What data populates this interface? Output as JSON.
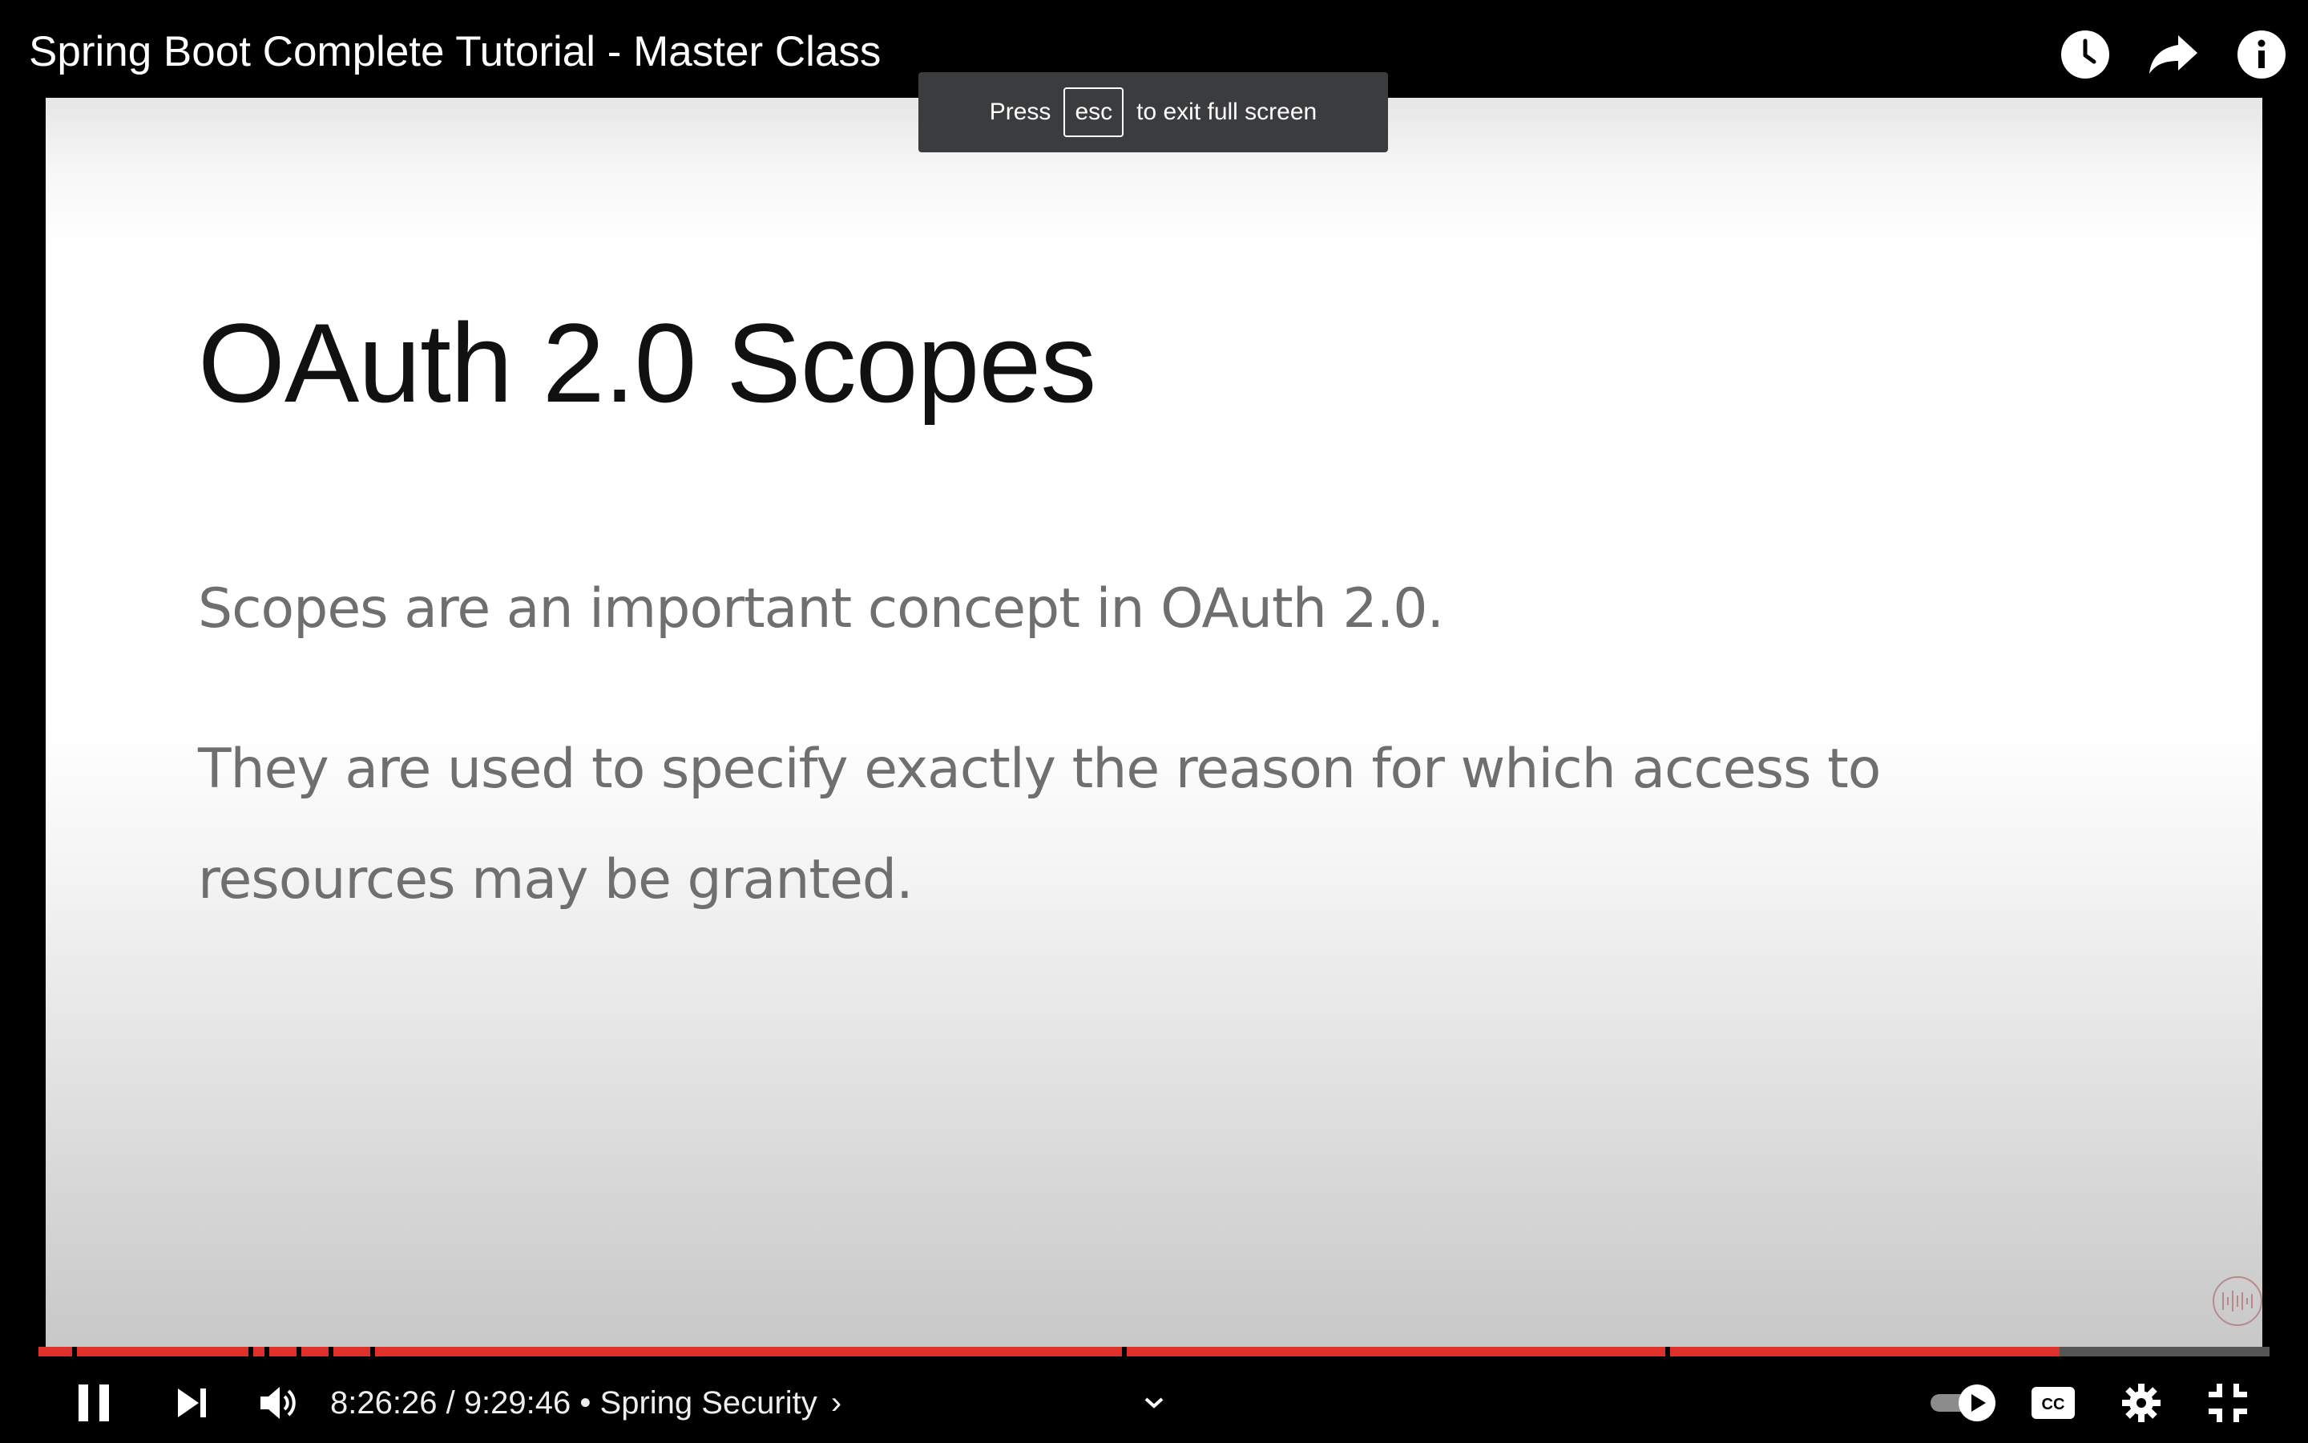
{
  "video": {
    "title": "Spring Boot Complete Tutorial - Master Class",
    "progress_fraction": 0.906
  },
  "fullscreen_hint": {
    "prefix": "Press",
    "key": "esc",
    "suffix": "to exit full screen"
  },
  "slide": {
    "title": "OAuth 2.0 Scopes",
    "paragraph1": "Scopes are an important concept in OAuth 2.0.",
    "paragraph2_line1": "They are used to specify exactly the reason for which access to",
    "paragraph2_line2": "resources may be granted."
  },
  "top_icons": [
    "clock-icon",
    "share-icon",
    "info-icon"
  ],
  "controls": {
    "current_time": "8:26:26",
    "separator": " / ",
    "duration": "9:29:46",
    "bullet": " • ",
    "chapter": "Spring Security",
    "chapter_chevron": "›"
  },
  "colors": {
    "progress_played": "#e0302a",
    "background": "#000000"
  }
}
